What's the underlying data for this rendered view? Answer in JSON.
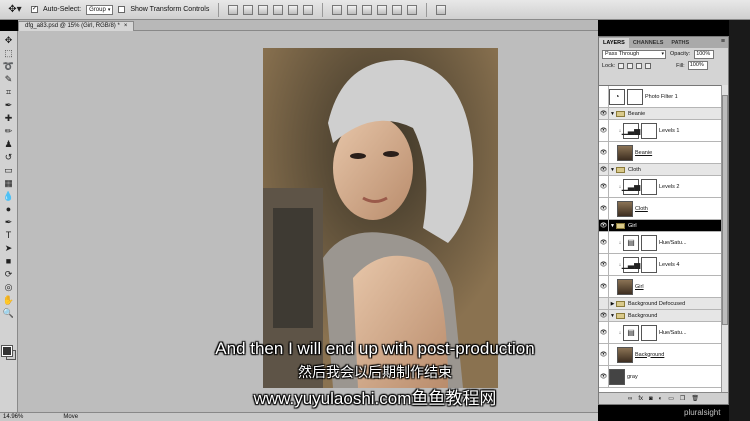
{
  "options_bar": {
    "auto_select_label": "Auto-Select:",
    "auto_select_value": "Group",
    "show_transform_label": "Show Transform Controls"
  },
  "document_tab": {
    "title": "dfg_a83.psd @ 15% (Girl, RGB/8) *",
    "close": "×"
  },
  "status_bar": {
    "zoom": "14.96%",
    "tool": "Move"
  },
  "layers_panel": {
    "tabs": [
      "LAYERS",
      "CHANNELS",
      "PATHS"
    ],
    "blend_mode": "Pass Through",
    "opacity_label": "Opacity:",
    "opacity_value": "100%",
    "lock_label": "Lock:",
    "fill_label": "Fill:",
    "fill_value": "100%",
    "layers": [
      {
        "name": "Photo Filter 1",
        "type": "adj",
        "visible": false,
        "indent": 0
      },
      {
        "name": "Beanie",
        "type": "group",
        "visible": true,
        "indent": 0
      },
      {
        "name": "Levels 1",
        "type": "adj",
        "visible": true,
        "indent": 1
      },
      {
        "name": "Beanie",
        "type": "pix",
        "visible": true,
        "indent": 1,
        "underline": true
      },
      {
        "name": "Cloth",
        "type": "group",
        "visible": true,
        "indent": 0
      },
      {
        "name": "Levels 2",
        "type": "adj",
        "visible": true,
        "indent": 1
      },
      {
        "name": "Cloth",
        "type": "pix",
        "visible": true,
        "indent": 1,
        "underline": true
      },
      {
        "name": "Girl",
        "type": "group",
        "visible": true,
        "indent": 0,
        "selected": true
      },
      {
        "name": "Hue/Satu...",
        "type": "adj",
        "visible": true,
        "indent": 1
      },
      {
        "name": "Levels 4",
        "type": "adj",
        "visible": true,
        "indent": 1
      },
      {
        "name": "Girl",
        "type": "pix",
        "visible": true,
        "indent": 1,
        "underline": true
      },
      {
        "name": "Background Defocused",
        "type": "group",
        "visible": false,
        "indent": 0
      },
      {
        "name": "Background",
        "type": "group",
        "visible": true,
        "indent": 0
      },
      {
        "name": "Hue/Satu...",
        "type": "adj",
        "visible": true,
        "indent": 1
      },
      {
        "name": "Background",
        "type": "pix",
        "visible": true,
        "indent": 1,
        "underline": true
      },
      {
        "name": "gray",
        "type": "gray",
        "visible": true,
        "indent": 0
      }
    ]
  },
  "subtitles": {
    "line1": "And then I will end up with post-production",
    "line2": "然后我会以后期制作结束",
    "line3": "www.yuyulaoshi.com鱼鱼教程网"
  },
  "watermark": "pluralsight"
}
